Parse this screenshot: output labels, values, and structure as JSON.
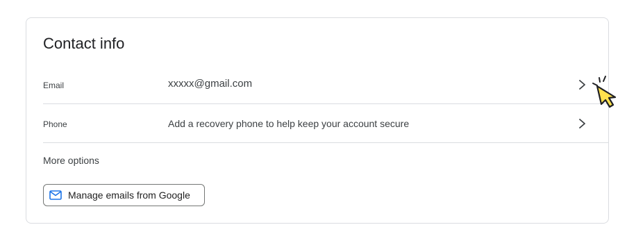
{
  "contact_info": {
    "title": "Contact info",
    "rows": [
      {
        "label": "Email",
        "value": "xxxxx@gmail.com"
      },
      {
        "label": "Phone",
        "value": "Add a recovery phone to help keep your account secure"
      }
    ],
    "more_options": "More options",
    "manage_button": {
      "label": "Manage emails from Google",
      "icon": "mail-icon"
    }
  },
  "colors": {
    "accent": "#1a73e8",
    "border": "#dadce0",
    "cursor_fill": "#ffe14d"
  }
}
